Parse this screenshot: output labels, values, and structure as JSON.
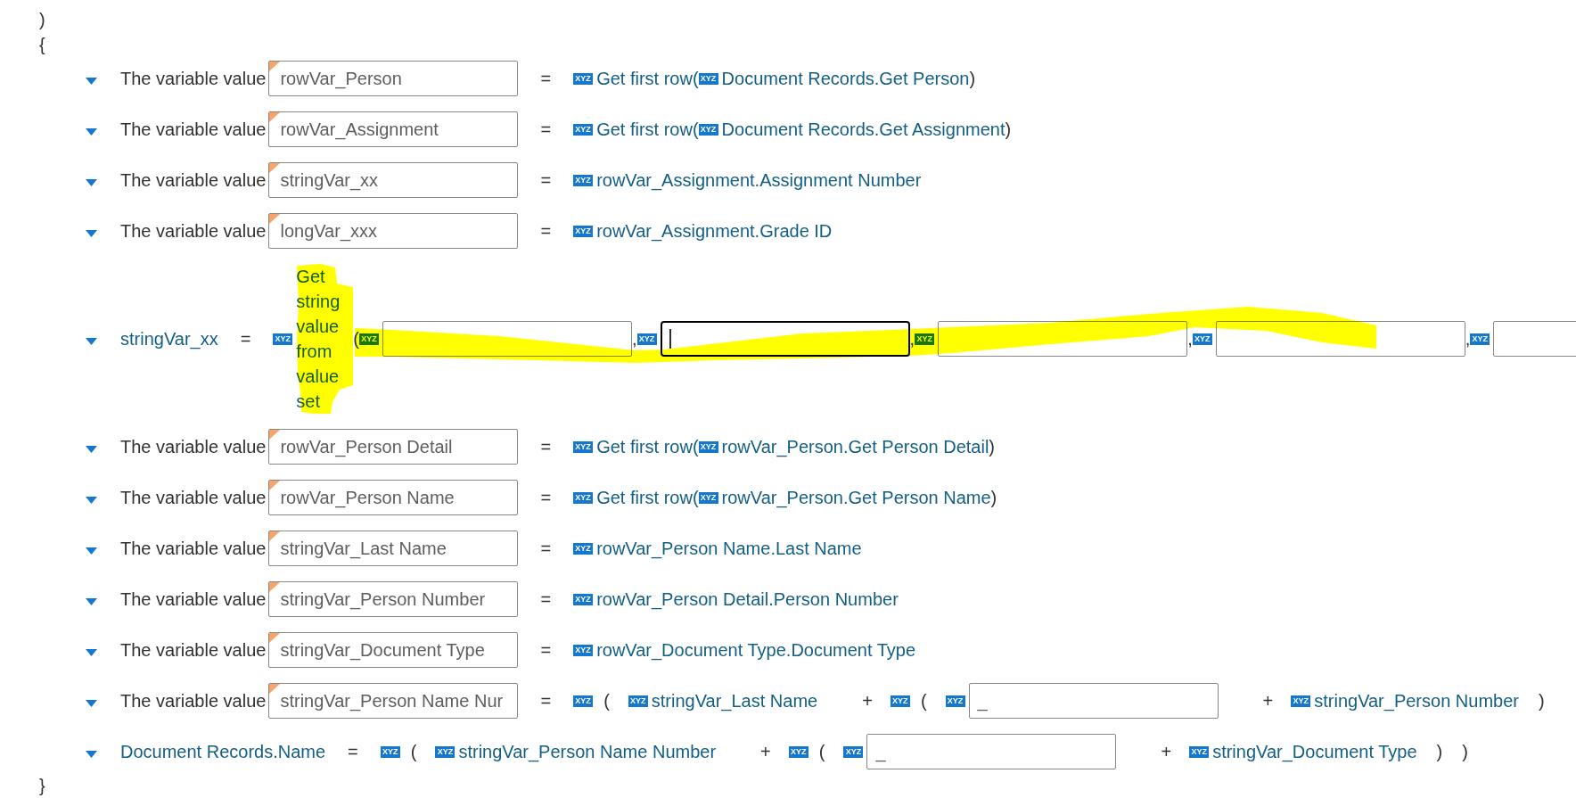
{
  "brackets_before": [
    ")",
    "{"
  ],
  "statements": [
    {
      "kind": "variable_value",
      "expanded": true,
      "label": "The variable value",
      "variable": "rowVar_Person",
      "equals": "=",
      "expression": [
        {
          "kind": "tag",
          "text": "XYZ"
        },
        {
          "kind": "text",
          "text": "Get first row("
        },
        {
          "kind": "tag",
          "text": "XYZ"
        },
        {
          "kind": "text",
          "text": "Document Records.Get Person"
        },
        {
          "kind": "sep",
          "text": ")"
        }
      ]
    },
    {
      "kind": "variable_value",
      "expanded": true,
      "label": "The variable value",
      "variable": "rowVar_Assignment",
      "equals": "=",
      "expression": [
        {
          "kind": "tag",
          "text": "XYZ"
        },
        {
          "kind": "text",
          "text": "Get first row("
        },
        {
          "kind": "tag",
          "text": "XYZ"
        },
        {
          "kind": "text",
          "text": "Document Records.Get Assignment"
        },
        {
          "kind": "sep",
          "text": ")"
        }
      ]
    },
    {
      "kind": "variable_value",
      "expanded": true,
      "label": "The variable value",
      "variable": "stringVar_xx",
      "equals": "=",
      "expression": [
        {
          "kind": "tag",
          "text": "XYZ"
        },
        {
          "kind": "text",
          "text": "rowVar_Assignment.Assignment Number"
        }
      ]
    },
    {
      "kind": "variable_value",
      "expanded": true,
      "label": "The variable value",
      "variable": "longVar_xxx",
      "equals": "=",
      "expression": [
        {
          "kind": "tag",
          "text": "XYZ"
        },
        {
          "kind": "text",
          "text": "rowVar_Assignment.Grade ID"
        }
      ]
    },
    {
      "kind": "function_call",
      "expanded": true,
      "target": "stringVar_xx",
      "equals": "=",
      "expression": [
        {
          "kind": "tag",
          "text": "XYZ"
        },
        {
          "kind": "func_name",
          "text": "Get string value from value set"
        },
        {
          "kind": "sep",
          "text": "("
        },
        {
          "kind": "tag",
          "text": "XYZ"
        },
        {
          "kind": "field",
          "focused": false
        },
        {
          "kind": "sep",
          "text": ","
        },
        {
          "kind": "tag",
          "text": "XYZ"
        },
        {
          "kind": "field",
          "focused": true
        },
        {
          "kind": "sep",
          "text": ","
        },
        {
          "kind": "tag",
          "text": "XYZ"
        },
        {
          "kind": "field",
          "focused": false
        },
        {
          "kind": "sep",
          "text": ","
        },
        {
          "kind": "tag",
          "text": "XYZ"
        },
        {
          "kind": "field",
          "focused": false
        },
        {
          "kind": "sep",
          "text": ","
        },
        {
          "kind": "tag",
          "text": "XYZ"
        },
        {
          "kind": "field",
          "focused": false
        }
      ]
    },
    {
      "kind": "variable_value",
      "expanded": true,
      "label": "The variable value",
      "variable": "rowVar_Person Detail",
      "equals": "=",
      "expression": [
        {
          "kind": "tag",
          "text": "XYZ"
        },
        {
          "kind": "text",
          "text": "Get first row("
        },
        {
          "kind": "tag",
          "text": "XYZ"
        },
        {
          "kind": "text",
          "text": "rowVar_Person.Get Person Detail"
        },
        {
          "kind": "sep",
          "text": ")"
        }
      ]
    },
    {
      "kind": "variable_value",
      "expanded": true,
      "label": "The variable value",
      "variable": "rowVar_Person Name",
      "equals": "=",
      "expression": [
        {
          "kind": "tag",
          "text": "XYZ"
        },
        {
          "kind": "text",
          "text": "Get first row("
        },
        {
          "kind": "tag",
          "text": "XYZ"
        },
        {
          "kind": "text",
          "text": "rowVar_Person.Get Person Name"
        },
        {
          "kind": "sep",
          "text": ")"
        }
      ]
    },
    {
      "kind": "variable_value",
      "expanded": true,
      "label": "The variable value",
      "variable": "stringVar_Last Name",
      "equals": "=",
      "expression": [
        {
          "kind": "tag",
          "text": "XYZ"
        },
        {
          "kind": "text",
          "text": "rowVar_Person Name.Last Name"
        }
      ]
    },
    {
      "kind": "variable_value",
      "expanded": true,
      "label": "The variable value",
      "variable": "stringVar_Person Number",
      "equals": "=",
      "expression": [
        {
          "kind": "tag",
          "text": "XYZ"
        },
        {
          "kind": "text",
          "text": "rowVar_Person Detail.Person Number"
        }
      ]
    },
    {
      "kind": "variable_value",
      "expanded": true,
      "label": "The variable value",
      "variable": "stringVar_Document Type",
      "equals": "=",
      "expression": [
        {
          "kind": "tag",
          "text": "XYZ"
        },
        {
          "kind": "text",
          "text": "rowVar_Document Type.Document Type"
        }
      ]
    },
    {
      "kind": "variable_value",
      "expanded": true,
      "label": "The variable value",
      "variable": "stringVar_Person Name Nur",
      "equals": "=",
      "expression": [
        {
          "kind": "tag",
          "text": "XYZ"
        },
        {
          "kind": "open",
          "text": "("
        },
        {
          "kind": "tag",
          "text": "XYZ"
        },
        {
          "kind": "text",
          "text": "stringVar_Last Name"
        },
        {
          "kind": "op",
          "text": "+"
        },
        {
          "kind": "tag",
          "text": "XYZ"
        },
        {
          "kind": "open",
          "text": "("
        },
        {
          "kind": "tag",
          "text": "XYZ"
        },
        {
          "kind": "field",
          "value": "_",
          "focused": false
        },
        {
          "kind": "op",
          "text": "+"
        },
        {
          "kind": "tag",
          "text": "XYZ"
        },
        {
          "kind": "text",
          "text": "stringVar_Person Number"
        },
        {
          "kind": "close",
          "text": ")"
        }
      ]
    },
    {
      "kind": "field_assign",
      "expanded": true,
      "target": "Document Records.Name",
      "equals": "=",
      "expression": [
        {
          "kind": "tag",
          "text": "XYZ"
        },
        {
          "kind": "open",
          "text": "("
        },
        {
          "kind": "tag",
          "text": "XYZ"
        },
        {
          "kind": "text",
          "text": "stringVar_Person Name Number"
        },
        {
          "kind": "op",
          "text": "+"
        },
        {
          "kind": "tag",
          "text": "XYZ"
        },
        {
          "kind": "open",
          "text": "("
        },
        {
          "kind": "tag",
          "text": "XYZ"
        },
        {
          "kind": "field",
          "value": "_",
          "focused": false
        },
        {
          "kind": "op",
          "text": "+"
        },
        {
          "kind": "tag",
          "text": "XYZ"
        },
        {
          "kind": "text",
          "text": "stringVar_Document Type"
        },
        {
          "kind": "close",
          "text": ")"
        },
        {
          "kind": "close",
          "text": ")"
        }
      ]
    }
  ],
  "bracket_after": "}"
}
